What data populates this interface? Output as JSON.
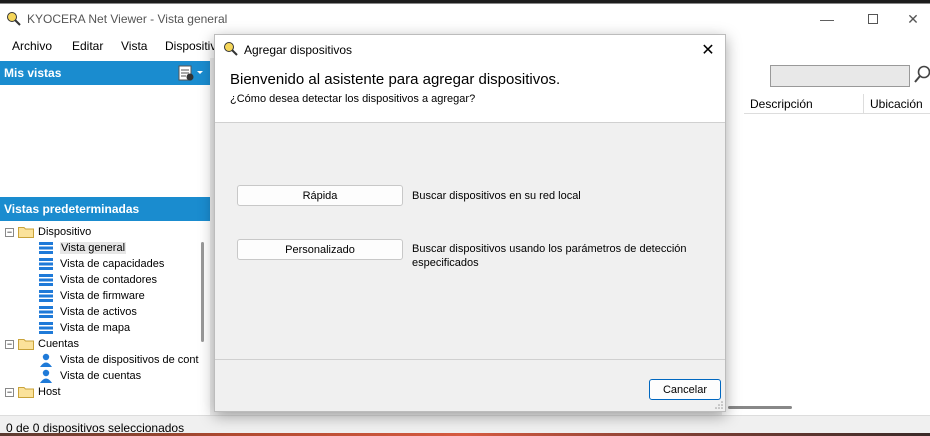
{
  "window": {
    "title": "KYOCERA Net Viewer - Vista general"
  },
  "menu": {
    "items": [
      "Archivo",
      "Editar",
      "Vista",
      "Dispositiv"
    ]
  },
  "left_panel": {
    "my_views_label": "Mis vistas",
    "default_views_label": "Vistas predeterminadas",
    "tree": {
      "device_folder": "Dispositivo",
      "device_views": [
        "Vista general",
        "Vista de capacidades",
        "Vista de contadores",
        "Vista de firmware",
        "Vista de activos",
        "Vista de mapa"
      ],
      "accounts_folder": "Cuentas",
      "account_views": [
        "Vista de dispositivos de cont",
        "Vista de cuentas"
      ],
      "host_folder": "Host",
      "selected": "Vista general"
    }
  },
  "right_panel": {
    "columns": [
      "Descripción",
      "Ubicación"
    ]
  },
  "status": {
    "text": "0 de 0 dispositivos seleccionados"
  },
  "dialog": {
    "title": "Agregar dispositivos",
    "heading": "Bienvenido al asistente para agregar dispositivos.",
    "subheading": "¿Cómo desea detectar los dispositivos a agregar?",
    "options": [
      {
        "button": "Rápida",
        "description": "Buscar dispositivos en su red local"
      },
      {
        "button": "Personalizado",
        "description": "Buscar dispositivos usando los parámetros de detección especificados"
      }
    ],
    "cancel_label": "Cancelar"
  },
  "colors": {
    "section_header": "#1a8ccf",
    "accent": "#0067c0",
    "device_icon": "#1f7ad8"
  },
  "icons": [
    "kyocera-app-icon",
    "minimize-icon",
    "maximize-icon",
    "close-icon",
    "views-menu-icon",
    "folder-icon",
    "device-view-icon",
    "user-icon",
    "search-icon"
  ]
}
